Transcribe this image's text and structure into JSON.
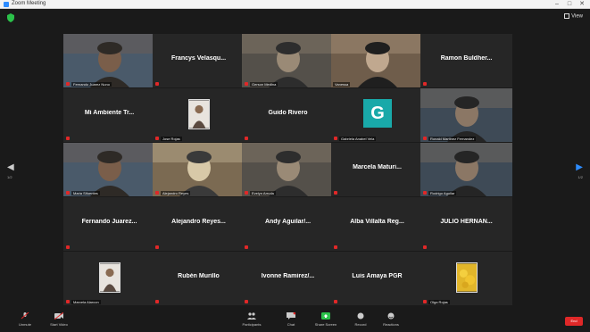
{
  "window": {
    "title": "Zoom Meeting",
    "minimize": "–",
    "maximize": "□",
    "close": "✕"
  },
  "topbar": {
    "view_label": "View"
  },
  "tiles": [
    {
      "type": "video",
      "label": "Fernando Juarez Nuno",
      "active": false,
      "muted": true
    },
    {
      "type": "name",
      "name": "Francys Velasqu...",
      "muted": true
    },
    {
      "type": "video",
      "label": "Gerson Medina",
      "active": false,
      "muted": true
    },
    {
      "type": "video",
      "label": "Vanessa",
      "active": true,
      "muted": false
    },
    {
      "type": "name",
      "name": "Ramon Buldher...",
      "muted": true
    },
    {
      "type": "name",
      "name": "Mi Ambiente Tr...",
      "muted": true
    },
    {
      "type": "photo",
      "label": "Jose Rojas",
      "muted": true
    },
    {
      "type": "name",
      "name": "Guido Rivero",
      "muted": true
    },
    {
      "type": "avatar",
      "letter": "G",
      "label": "Gabriela Anabel Vela",
      "muted": true
    },
    {
      "type": "video",
      "label": "Ronald Martinez Fernandez",
      "active": false,
      "muted": true
    },
    {
      "type": "video",
      "label": "Maria Sifuentes",
      "active": false,
      "muted": true
    },
    {
      "type": "video",
      "label": "Alejandro Reyes",
      "active": false,
      "muted": true
    },
    {
      "type": "video",
      "label": "Evelyn Arruda",
      "active": false,
      "muted": true
    },
    {
      "type": "name",
      "name": "Marcela Maturi...",
      "muted": true
    },
    {
      "type": "video",
      "label": "Rodrigo Aguilar",
      "active": false,
      "muted": true
    },
    {
      "type": "name",
      "name": "Fernando Juarez...",
      "muted": true
    },
    {
      "type": "name",
      "name": "Alejandro Reyes...",
      "muted": true
    },
    {
      "type": "name",
      "name": "Andy Aguilar/...",
      "muted": true
    },
    {
      "type": "name",
      "name": "Alba Villalta Reg...",
      "muted": true
    },
    {
      "type": "name",
      "name": "JULIO HERNAN...",
      "muted": true
    },
    {
      "type": "photo",
      "label": "Marcela Alarcon",
      "muted": true
    },
    {
      "type": "name",
      "name": "Rubén Murillo",
      "muted": true
    },
    {
      "type": "name",
      "name": "Ivonne Ramirez/...",
      "muted": true
    },
    {
      "type": "name",
      "name": "Luis Amaya PGR",
      "muted": true
    },
    {
      "type": "flower",
      "label": "Olga Rojas",
      "muted": true
    }
  ],
  "pager": {
    "left": "1/2",
    "right": "1/2"
  },
  "toolbar": {
    "unmute": "Unmute",
    "start_video": "Start Video",
    "participants": "Participants",
    "participants_count": "25",
    "chat": "Chat",
    "share_screen": "Share Screen",
    "record": "Record",
    "reactions": "Reactions",
    "end": "End"
  },
  "colors": {
    "accent": "#2d8cff",
    "end": "#e02828",
    "active_border": "#c8c850",
    "tile_bg": "#262626"
  }
}
